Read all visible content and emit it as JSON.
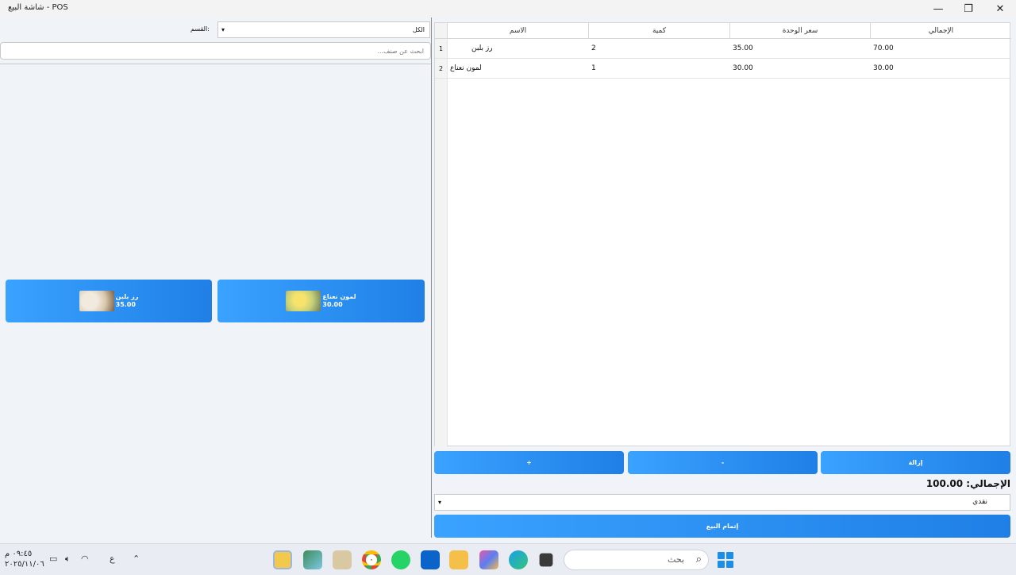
{
  "window": {
    "title": "شاشة البيع - POS",
    "minimize": "—",
    "restore": "❐",
    "close": "✕"
  },
  "left": {
    "category_label": "القسم:",
    "category_value": "الكل",
    "search_placeholder": "ابحث عن صنف...",
    "products": [
      {
        "name": "رز بلبن",
        "price": "35.00",
        "image": "rice-pudding-image"
      },
      {
        "name": "لمون نعناع",
        "price": "30.00",
        "image": "lemon-mint-image"
      }
    ]
  },
  "cart": {
    "columns": [
      "الاسم",
      "كمية",
      "سعر الوحدة",
      "الإجمالي"
    ],
    "rows": [
      {
        "num": "1",
        "name": "رز بلبن",
        "qty": "2",
        "unit": "35.00",
        "total": "70.00"
      },
      {
        "num": "2",
        "name": "لمون نعناع",
        "qty": "1",
        "unit": "30.00",
        "total": "30.00"
      }
    ]
  },
  "actions": {
    "plus": "+",
    "minus": "-",
    "remove": "إزالة"
  },
  "summary": {
    "total_text": "الإجمالي: 100.00",
    "payment_method": "نقدي",
    "complete_label": "إتمام البيع"
  },
  "taskbar": {
    "time": "٠٩:٤٥ م",
    "date": "٢٠٢٥/١١/٠٦",
    "lang": "ع",
    "search_placeholder": "بحث",
    "chevron": "⌃"
  },
  "colors": {
    "button_start": "#3aa2ff",
    "button_end": "#1f7fe6",
    "panel_bg": "#f0f4f9"
  }
}
